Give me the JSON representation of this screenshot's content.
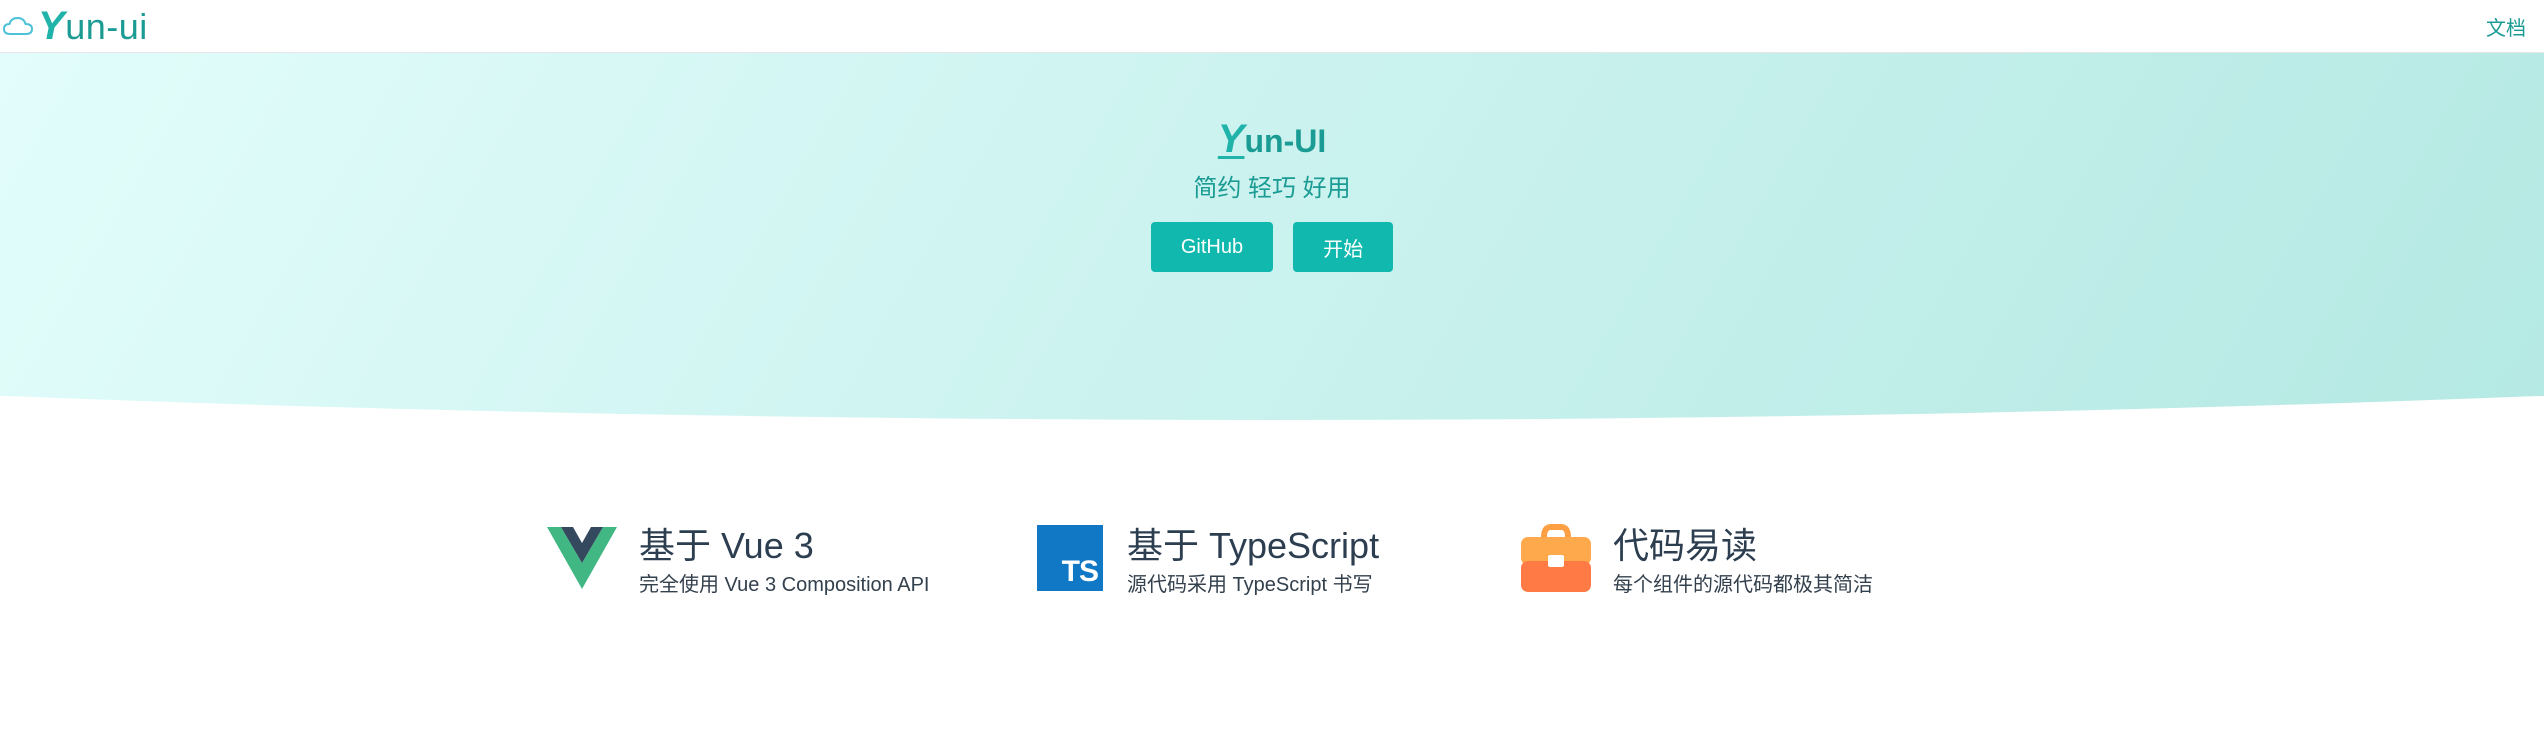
{
  "nav": {
    "brand_initial": "Y",
    "brand_rest": "un-ui",
    "doc_link": "文档",
    "logo_icon": "cloud-icon"
  },
  "hero": {
    "title_initial": "Y",
    "title_rest": "un-UI",
    "subtitle": "简约 轻巧 好用",
    "buttons": [
      {
        "label": "GitHub"
      },
      {
        "label": "开始"
      }
    ]
  },
  "features": [
    {
      "icon": "vue-logo-icon",
      "title": "基于 Vue 3",
      "desc": "完全使用 Vue 3 Composition API"
    },
    {
      "icon": "typescript-logo-icon",
      "icon_text": "TS",
      "title": "基于 TypeScript",
      "desc": "源代码采用 TypeScript 书写"
    },
    {
      "icon": "toolbox-icon",
      "title": "代码易读",
      "desc": "每个组件的源代码都极其简洁"
    }
  ],
  "colors": {
    "accent": "#1a9b93",
    "button": "#10b8ad",
    "hero_start": "#e2fdfb",
    "hero_end": "#b5e9e3",
    "ts_blue": "#1178c6",
    "toolbox_orange": "#ff7a45"
  }
}
